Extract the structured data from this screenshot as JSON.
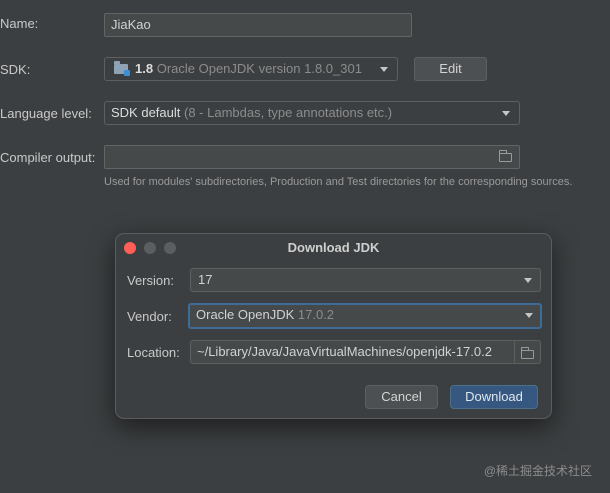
{
  "form": {
    "name_label": "Name:",
    "name_value": "JiaKao",
    "sdk_label": "SDK:",
    "sdk_version": "1.8",
    "sdk_description": "Oracle OpenJDK version 1.8.0_301",
    "sdk_edit_button": "Edit",
    "language_level_label": "Language level:",
    "language_level_value": "SDK default",
    "language_level_detail": "(8 - Lambdas, type annotations etc.)",
    "compiler_output_label": "Compiler output:",
    "compiler_output_value": "",
    "compiler_output_hint": "Used for modules' subdirectories, Production and Test directories for the corresponding sources."
  },
  "dialog": {
    "title": "Download JDK",
    "version_label": "Version:",
    "version_value": "17",
    "vendor_label": "Vendor:",
    "vendor_name": "Oracle OpenJDK",
    "vendor_version": "17.0.2",
    "location_label": "Location:",
    "location_value": "~/Library/Java/JavaVirtualMachines/openjdk-17.0.2",
    "cancel_button": "Cancel",
    "download_button": "Download"
  },
  "watermark": "@稀土掘金技术社区",
  "colors": {
    "background": "#3c3f41",
    "close": "#ff5f57",
    "inactive_traffic": "#5b5d5f",
    "primary_button": "#365880",
    "focus_border": "#3d6c99"
  },
  "icons": {
    "sdk": "folder-sdk-icon",
    "dropdown": "chevron-down-icon",
    "browse": "folder-icon"
  }
}
